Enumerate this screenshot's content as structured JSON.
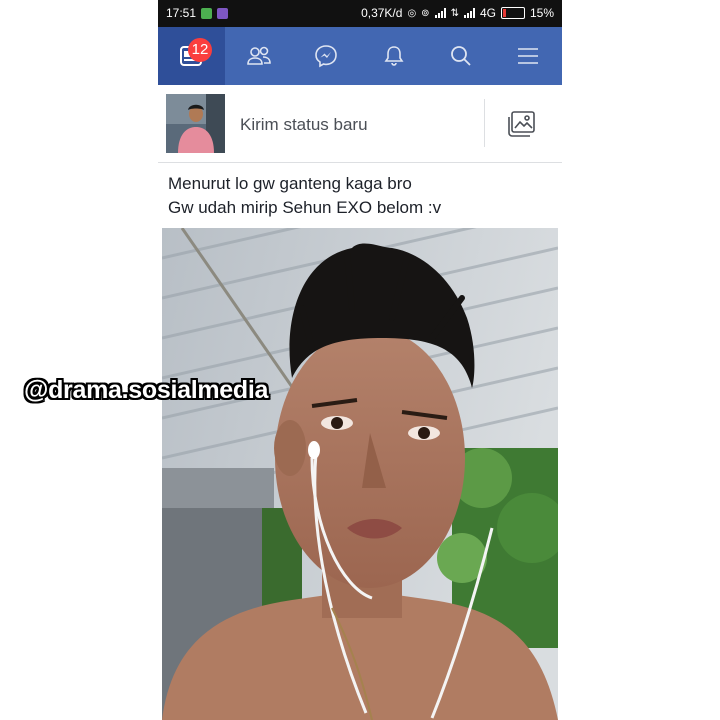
{
  "status_bar": {
    "time": "17:51",
    "network_speed": "0,37K/d",
    "network_type": "4G",
    "battery": "15%",
    "battery_level": 0.15
  },
  "navbar": {
    "color": "#4267b2",
    "items": [
      {
        "icon": "news-feed-icon",
        "badge": "12"
      },
      {
        "icon": "friends-icon"
      },
      {
        "icon": "messenger-icon"
      },
      {
        "icon": "bell-icon"
      },
      {
        "icon": "search-icon"
      },
      {
        "icon": "menu-icon"
      }
    ]
  },
  "composer": {
    "placeholder": "Kirim status baru",
    "photo_button_icon": "photo-icon"
  },
  "post": {
    "text_line1": "Menurut lo gw ganteng kaga bro",
    "text_line2": "Gw udah mirip Sehun EXO belom :v"
  },
  "watermark": "@drama.sosialmedia"
}
